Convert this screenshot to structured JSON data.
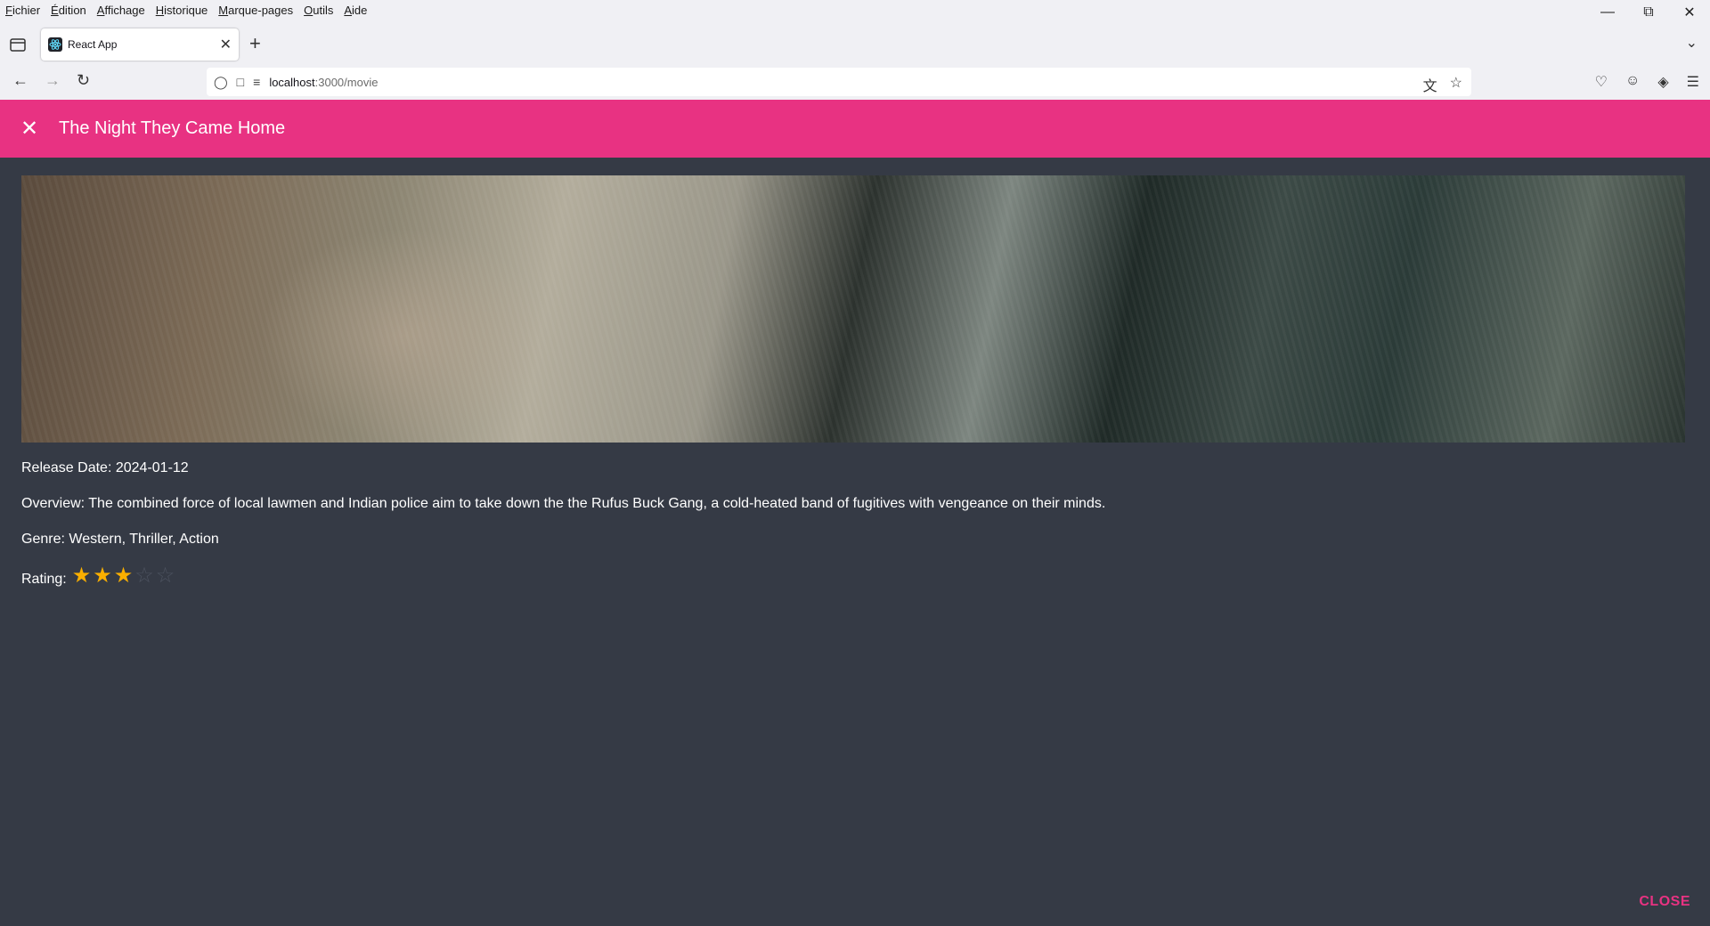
{
  "browser": {
    "menu": [
      "Fichier",
      "Édition",
      "Affichage",
      "Historique",
      "Marque-pages",
      "Outils",
      "Aide"
    ],
    "tab_title": "React App",
    "url_host": "localhost",
    "url_path": ":3000/movie"
  },
  "dialog": {
    "title": "The Night They Came Home",
    "release_label": "Release Date:",
    "release_date": "2024-01-12",
    "overview_label": "Overview:",
    "overview": "The combined force of local lawmen and Indian police aim to take down the the Rufus Buck Gang, a cold-heated band of fugitives with vengeance on their minds.",
    "genre_label": "Genre:",
    "genres": "Western, Thriller, Action",
    "rating_label": "Rating:",
    "rating": 3,
    "rating_max": 5,
    "close_label": "CLOSE",
    "accent_color": "#e83282",
    "star_color": "#faaf00"
  }
}
